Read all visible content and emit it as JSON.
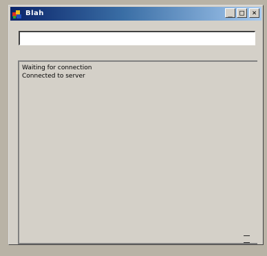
{
  "window": {
    "title": "Blah"
  },
  "title_buttons": {
    "minimize": "_",
    "maximize": "□",
    "close": "×"
  },
  "url_input": {
    "value": "",
    "placeholder": ""
  },
  "log": {
    "lines": [
      "Waiting for connection",
      "Connected to server"
    ]
  },
  "colors": {
    "title_start": "#0a246a",
    "title_end": "#a6caf0",
    "face": "#d4d0c8"
  },
  "icons": {
    "app": "app-window-icon",
    "minimize": "minimize-icon",
    "maximize": "maximize-icon",
    "close": "close-icon"
  }
}
